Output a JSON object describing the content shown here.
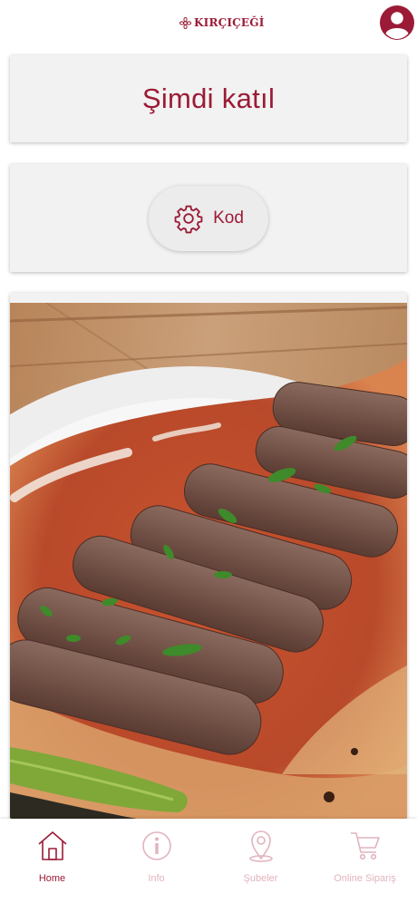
{
  "header": {
    "logo_text": "KIRÇIÇEĞİ",
    "profile_icon": "user-circle-icon"
  },
  "join_card": {
    "title": "Şimdi katıl"
  },
  "code_card": {
    "button_label": "Kod",
    "button_icon": "gear-icon"
  },
  "promo": {
    "image": "adana-kebab-photo"
  },
  "bottom_nav": {
    "items": [
      {
        "label": "Home",
        "icon": "home-icon",
        "active": true
      },
      {
        "label": "Info",
        "icon": "info-icon",
        "active": false
      },
      {
        "label": "Şubeler",
        "icon": "location-pin-icon",
        "active": false
      },
      {
        "label": "Online Sipariş",
        "icon": "shopping-cart-icon",
        "active": false
      }
    ]
  },
  "colors": {
    "brand": "#9b1b36",
    "brand_light": "#e2b3bd",
    "card_bg": "#f2f2f2"
  }
}
